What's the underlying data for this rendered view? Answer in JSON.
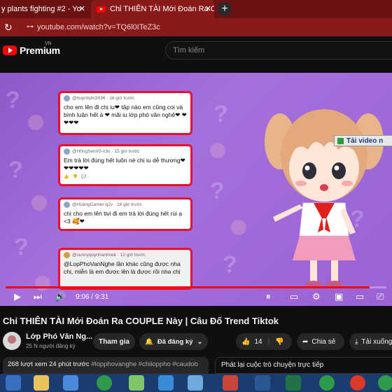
{
  "browser": {
    "tabs": [
      {
        "label": "y plants fighting #2 - Yo",
        "active": false
      },
      {
        "label": "Chỉ THIÊN TÀI Mới Đoán Ra COU",
        "active": true
      }
    ],
    "new_tab_label": "+",
    "url": "youtube.com/watch?v=TQ6l0ITeZ3c"
  },
  "youtube": {
    "logo_text": "Premium",
    "region": "VN",
    "search_placeholder": "Tìm kiếm"
  },
  "player": {
    "download_button": "Tải video n",
    "current_time": "9:06",
    "duration": "9:31",
    "time_display": "9:06 / 9:31",
    "progress_fraction": 0.956,
    "comments": [
      {
        "user": "@huynhphi3036 · 16 giờ trước",
        "text": "cho em lên đi chị iu❤ tập nào em cũng coi và bình luận hết á ❤ mãi iu lớp phó văn nghệ❤ ❤❤❤❤"
      },
      {
        "user": "@HồngSenVõ-n3o · 15 giờ trước",
        "text": "Em trả lời đúng hết luôn nè chị iu dễ thương❤ ❤❤❤❤❤"
      },
      {
        "user": "@HoàngGamer-q2v · 16 giờ trước",
        "text": "chị cho em lên tivi đi em trả lời đúng hết rùi ạ <3 🥰❤"
      },
      {
        "user": "@sunnyquynhanhnek · 12 giờ trước",
        "text": "@LopPhoVanNghe lần khác cũng được nha chị, miễn là em được lên là được rồi nha chị"
      }
    ]
  },
  "video": {
    "title": "Chỉ THIÊN TÀI Mới Đoán Ra COUPLE Này | Câu Đố Trend Tiktok",
    "channel_name": "Lớp Phó Văn Ng...",
    "subscribers": "25 N người đăng ký",
    "join_label": "Tham gia",
    "subscribed_label": "Đã đăng ký",
    "like_count": "14",
    "share_label": "Chia sẻ",
    "download_label": "Tải xuống"
  },
  "description": {
    "stats": "268 lượt xem  24 phút trước",
    "tags": "#lopphovanghe #chiloppho #caudob"
  },
  "chat": {
    "label": "Phát lại cuộc trò chuyện trực tiếp"
  },
  "colors": {
    "tab_bar": "#6b1212",
    "address_bar": "#8a1a1a",
    "brand_red": "#ff0000",
    "card_border": "#e8112d",
    "video_bg": "#9a62d3",
    "taskbar": "#1b3c6e"
  }
}
